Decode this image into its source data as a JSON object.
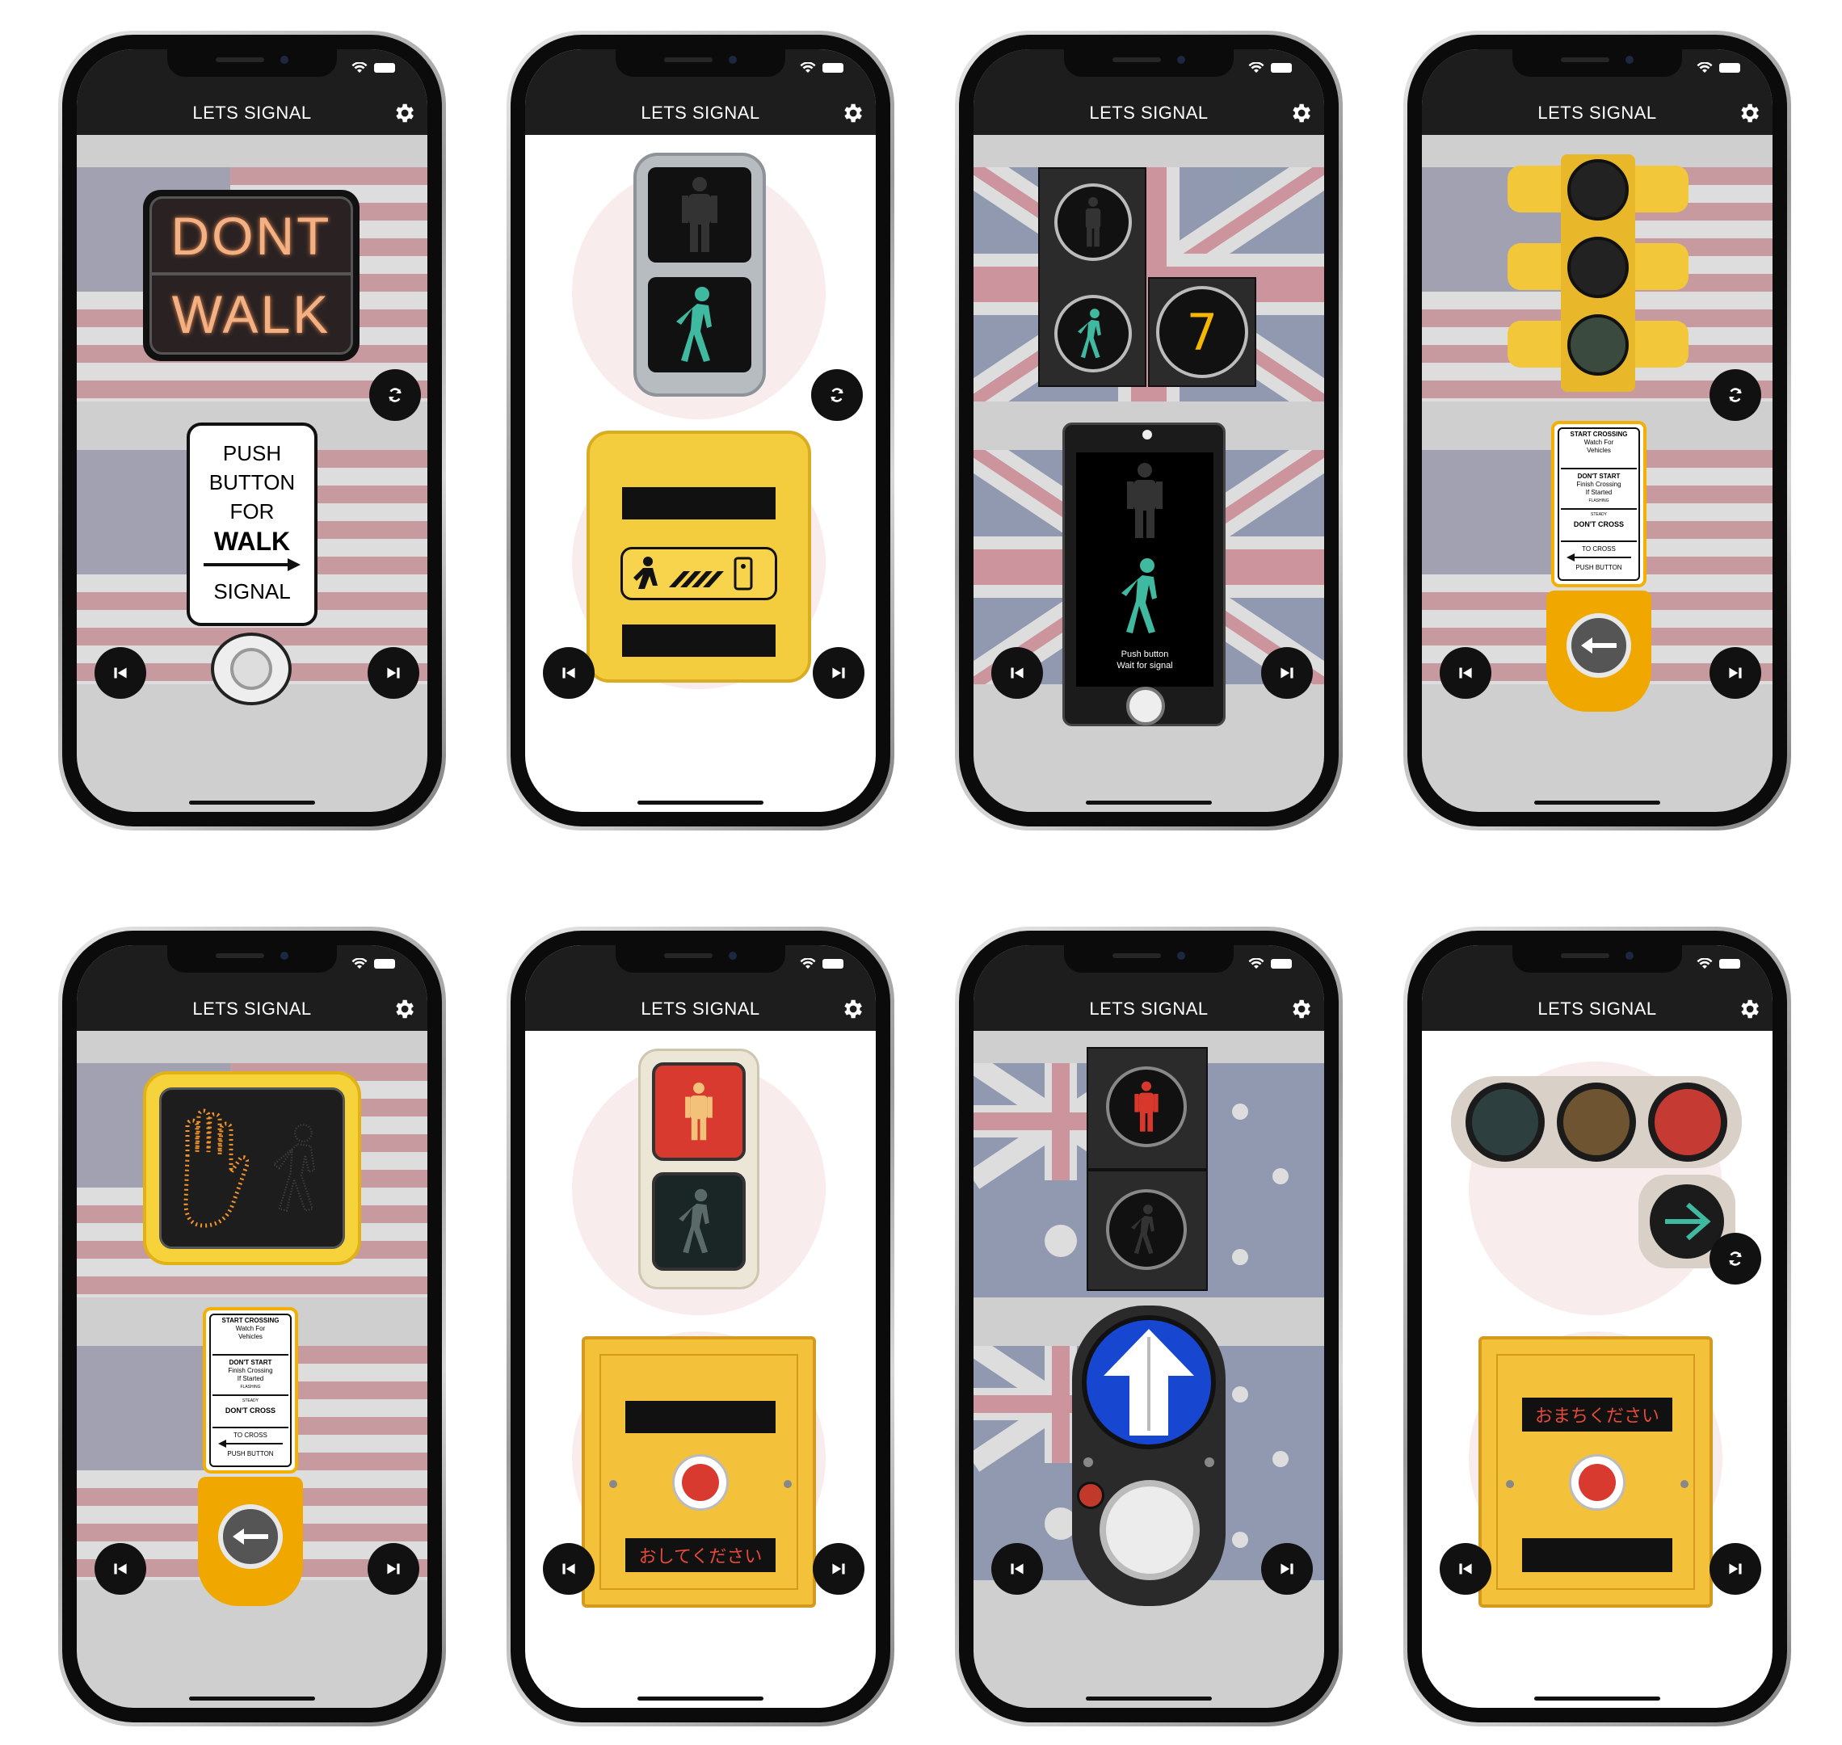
{
  "app": {
    "title": "LETS SIGNAL"
  },
  "icons": {
    "settings": "gear-icon",
    "previous": "skip-previous-icon",
    "next": "skip-next-icon",
    "switch": "refresh-icon",
    "wifi": "wifi-icon",
    "battery": "battery-icon"
  },
  "colors": {
    "appbar": "#1d1d1d",
    "signal_yellow": "#f2c94c",
    "walk_green": "#3fb9a0",
    "dont_walk_orange": "#f3b082",
    "background_grey": "#cfcfcf"
  },
  "screens": [
    {
      "signal_text": {
        "line1": "DONT",
        "line2": "WALK"
      },
      "sign": {
        "line1": "PUSH",
        "line2": "BUTTON",
        "line3": "FOR",
        "line4": "WALK",
        "line5": "SIGNAL"
      }
    },
    {},
    {
      "countdown": "7",
      "panel": {
        "line1": "Push button",
        "line2": "Wait for signal"
      }
    },
    {
      "instructions": {
        "start_title": "START CROSSING",
        "start_sub1": "Watch For",
        "start_sub2": "Vehicles",
        "dontstart_title": "DON'T START",
        "dontstart_sub1": "Finish Crossing",
        "dontstart_sub2": "If Started",
        "flashing": "FLASHING",
        "steady": "STEADY",
        "dontcross": "DON'T CROSS",
        "tocross": "TO CROSS",
        "pushbutton": "PUSH BUTTON"
      }
    },
    {
      "instructions": {
        "start_title": "START CROSSING",
        "start_sub1": "Watch For",
        "start_sub2": "Vehicles",
        "dontstart_title": "DON'T START",
        "dontstart_sub1": "Finish Crossing",
        "dontstart_sub2": "If Started",
        "flashing": "FLASHING",
        "steady": "STEADY",
        "dontcross": "DON'T CROSS",
        "tocross": "TO CROSS",
        "pushbutton": "PUSH BUTTON"
      }
    },
    {
      "button_label": "おしてください"
    },
    {},
    {
      "wait_label": "おまちください"
    }
  ]
}
